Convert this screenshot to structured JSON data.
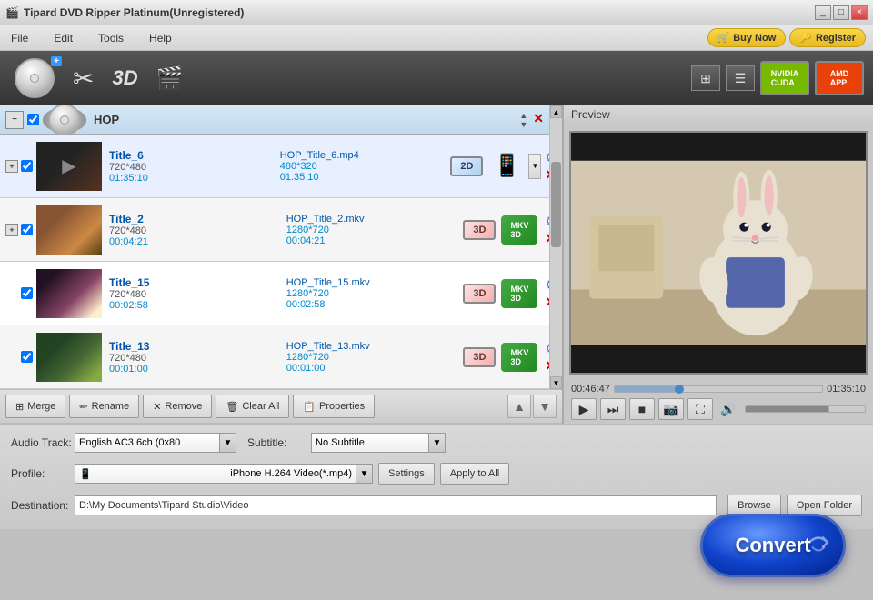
{
  "window": {
    "title": "Tipard DVD Ripper Platinum(Unregistered)",
    "controls": [
      "_",
      "□",
      "×"
    ]
  },
  "menubar": {
    "items": [
      "File",
      "Edit",
      "Tools",
      "Help"
    ],
    "buy_label": "Buy Now",
    "register_label": "Register"
  },
  "toolbar": {
    "load_dvd_label": "Load DVD",
    "edit_label": "Edit",
    "3d_label": "3D",
    "effects_label": "Effects"
  },
  "list_header": {
    "title": "HOP"
  },
  "videos": [
    {
      "title": "Title_6",
      "dimensions": "720*480",
      "duration": "01:35:10",
      "output_name": "HOP_Title_6.mp4",
      "output_dims": "480*320",
      "output_dur": "01:35:10",
      "badge": "2D",
      "selected": true,
      "thumb_class": "thumb-1"
    },
    {
      "title": "Title_2",
      "dimensions": "720*480",
      "duration": "00:04:21",
      "output_name": "HOP_Title_2.mkv",
      "output_dims": "1280*720",
      "output_dur": "00:04:21",
      "badge": "3D",
      "selected": true,
      "thumb_class": "thumb-2"
    },
    {
      "title": "Title_15",
      "dimensions": "720*480",
      "duration": "00:02:58",
      "output_name": "HOP_Title_15.mkv",
      "output_dims": "1280*720",
      "output_dur": "00:02:58",
      "badge": "3D",
      "selected": true,
      "thumb_class": "thumb-3"
    },
    {
      "title": "Title_13",
      "dimensions": "720*480",
      "duration": "00:01:00",
      "output_name": "HOP_Title_13.mkv",
      "output_dims": "1280*720",
      "output_dur": "00:01:00",
      "badge": "3D",
      "selected": true,
      "thumb_class": "thumb-4"
    }
  ],
  "list_buttons": {
    "merge": "Merge",
    "rename": "Rename",
    "remove": "Remove",
    "clear_all": "Clear All",
    "properties": "Properties"
  },
  "bottom": {
    "audio_track_label": "Audio Track:",
    "audio_track_value": "English AC3 6ch (0x80",
    "subtitle_label": "Subtitle:",
    "subtitle_value": "No Subtitle",
    "profile_label": "Profile:",
    "profile_value": "iPhone H.264 Video(*.mp4)",
    "settings_label": "Settings",
    "apply_to_all_label": "Apply to All",
    "destination_label": "Destination:",
    "destination_value": "D:\\My Documents\\Tipard Studio\\Video",
    "browse_label": "Browse",
    "open_folder_label": "Open Folder"
  },
  "preview": {
    "label": "Preview",
    "time_current": "00:46:47",
    "time_end": "01:35:10"
  },
  "convert": {
    "label": "Convert"
  }
}
